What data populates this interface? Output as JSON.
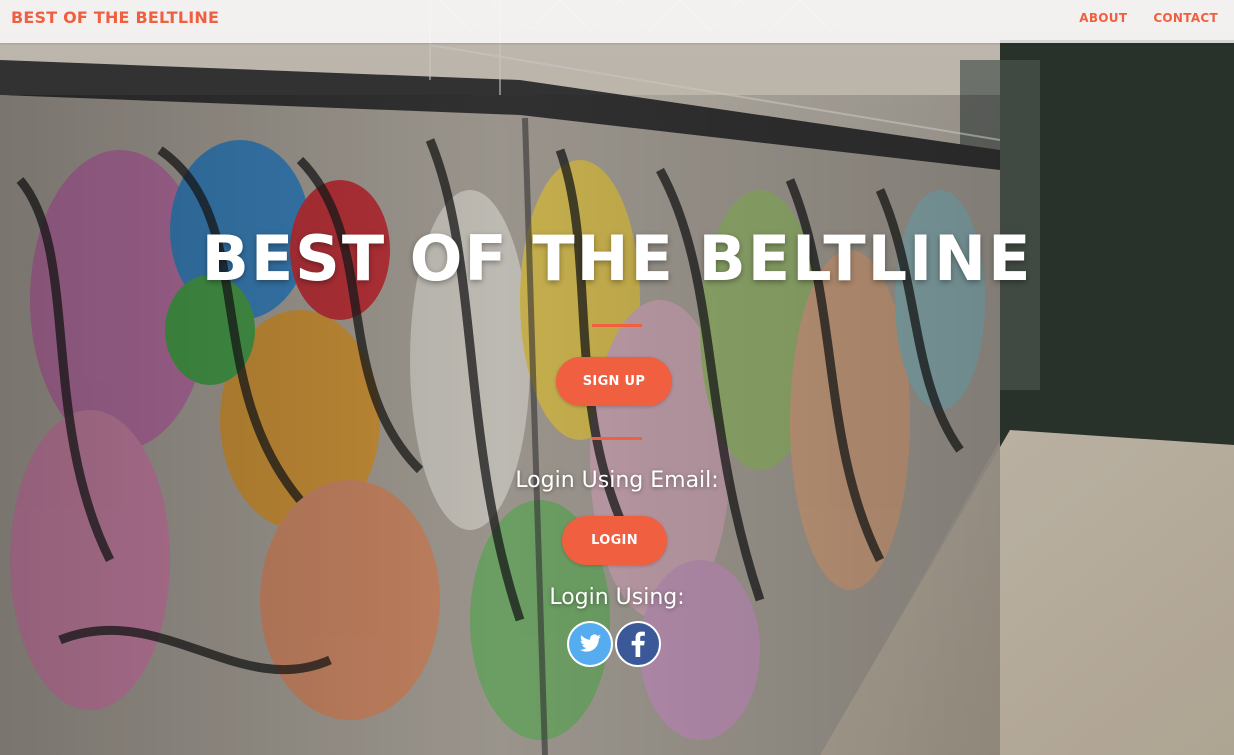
{
  "navbar": {
    "brand": "BEST OF THE BELTLINE",
    "links": [
      "ABOUT",
      "CONTACT"
    ]
  },
  "hero": {
    "title": "BEST OF THE BELTLINE",
    "signup_label": "SIGN UP",
    "email_prompt": "Login Using Email:",
    "login_label": "LOGIN",
    "social_prompt": "Login Using:"
  },
  "social": {
    "twitter_icon": "twitter-icon",
    "facebook_icon": "facebook-icon"
  },
  "colors": {
    "accent": "#f05f40",
    "twitter": "#55acee",
    "facebook": "#3b5998"
  }
}
